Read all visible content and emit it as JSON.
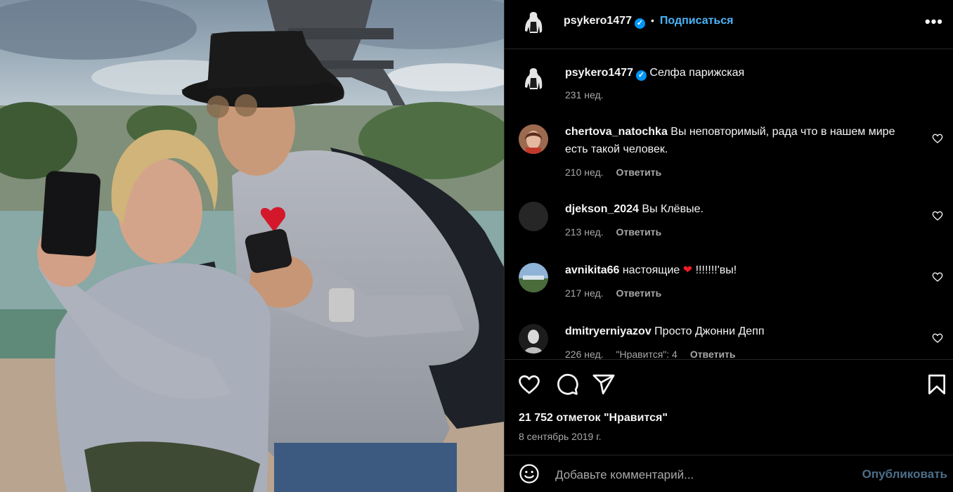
{
  "post": {
    "username": "psykero1477",
    "verified_icon": "verified-badge-icon",
    "follow_label": "Подписаться",
    "separator": "•",
    "more_label": "•••",
    "photo_alt": "Селфа парижская"
  },
  "caption": {
    "username": "psykero1477",
    "text": "Селфа парижская",
    "time": "231 нед."
  },
  "comments": [
    {
      "username": "chertova_natochka",
      "text": "Вы неповторимый, рада что в нашем мире есть такой человек.",
      "time": "210 нед.",
      "reply": "Ответить"
    },
    {
      "username": "djekson_2024",
      "text": "Вы Клёвые.",
      "time": "213 нед.",
      "reply": "Ответить"
    },
    {
      "username": "avnikita66",
      "text_before": "настоящие",
      "emoji": "❤",
      "text_after": "!!!!!!!'вы!",
      "time": "217 нед.",
      "reply": "Ответить"
    },
    {
      "username": "dmitryerniyazov",
      "text": "Просто Джонни Депп",
      "time": "226 нед.",
      "likes": "\"Нравится\": 4",
      "reply": "Ответить"
    }
  ],
  "actions": {
    "like_icon": "heart-icon",
    "comment_icon": "comment-icon",
    "share_icon": "share-icon",
    "save_icon": "bookmark-icon"
  },
  "likes_text": "21 752 отметок \"Нравится\"",
  "date_text": "8 сентябрь 2019 г.",
  "add_comment": {
    "emoji_icon": "emoji-icon",
    "placeholder": "Добавьте комментарий...",
    "publish_label": "Опубликовать"
  },
  "colors": {
    "background": "#000000",
    "link_blue": "#4cb5f9",
    "verified_blue": "#0095f6",
    "muted_text": "#a8a8a8",
    "divider": "#262626",
    "emoji_red": "#ed1c24"
  }
}
